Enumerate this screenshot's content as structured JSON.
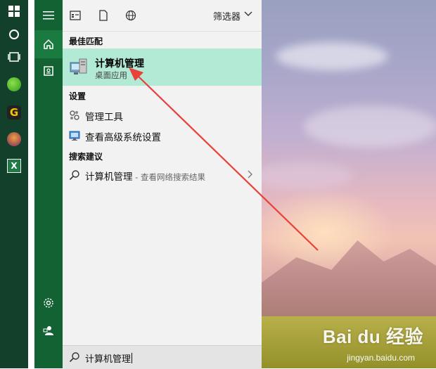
{
  "taskbar": {
    "items": [
      {
        "name": "windows-logo-icon"
      },
      {
        "name": "cortana-circle-icon"
      },
      {
        "name": "task-view-icon"
      },
      {
        "name": "green-app-icon"
      },
      {
        "name": "yellow-g-app-icon"
      },
      {
        "name": "game-app-icon"
      },
      {
        "name": "excel-app-icon"
      }
    ]
  },
  "rail": {
    "items": [
      {
        "name": "hamburger-menu-icon"
      },
      {
        "name": "home-icon"
      },
      {
        "name": "notebook-icon"
      },
      {
        "name": "settings-gear-icon"
      },
      {
        "name": "feedback-person-icon"
      }
    ]
  },
  "filters": {
    "label": "筛选器",
    "icons": [
      "apps-filter-icon",
      "documents-filter-icon",
      "web-filter-icon"
    ]
  },
  "best_match": {
    "heading": "最佳匹配",
    "title": "计算机管理",
    "subtitle": "桌面应用"
  },
  "settings": {
    "heading": "设置",
    "items": [
      {
        "label": "管理工具",
        "icon": "admin-tools-icon"
      },
      {
        "label": "查看高级系统设置",
        "icon": "monitor-settings-icon"
      }
    ]
  },
  "suggestions": {
    "heading": "搜索建议",
    "items": [
      {
        "label": "计算机管理",
        "sub": " - 查看网络搜索结果",
        "icon": "search-icon"
      }
    ]
  },
  "search": {
    "value": "计算机管理"
  },
  "watermark": {
    "brand": "Bai du 经验",
    "url": "jingyan.baidu.com"
  },
  "colors": {
    "taskbar": "#13402b",
    "rail": "#136234",
    "highlight": "#b2ead6",
    "panel": "#f2f2f2",
    "arrow": "#e8413a"
  }
}
